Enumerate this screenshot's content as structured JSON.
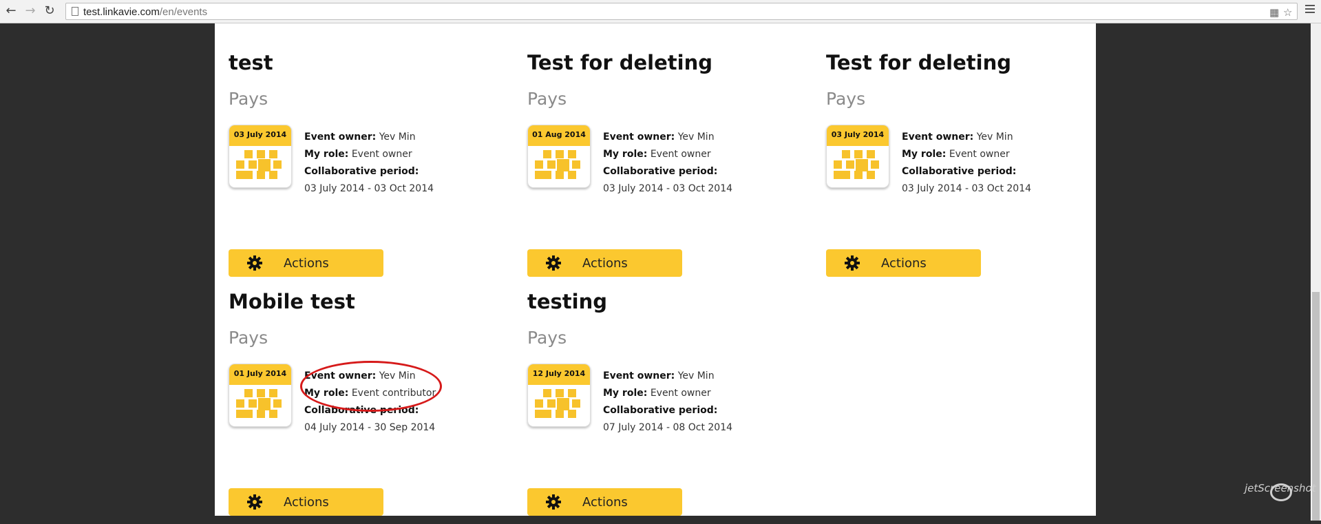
{
  "browser": {
    "url_host": "test.linkavie.com",
    "url_path": "/en/events",
    "back_icon": "arrow-left-icon",
    "forward_icon": "arrow-right-icon",
    "reload_icon": "reload-icon",
    "page_icon": "page-icon",
    "translate_icon": "translate-icon",
    "star_icon": "star-icon",
    "menu_icon": "menu-icon"
  },
  "events": [
    {
      "title": "test",
      "subtitle": "Pays",
      "date": "03 July 2014",
      "owner_label": "Event owner:",
      "owner": "Yev Min",
      "role_label": "My role:",
      "role": "Event owner",
      "period_label": "Collaborative period:",
      "period": "03 July 2014 - 03 Oct 2014",
      "actions_label": "Actions"
    },
    {
      "title": "Test for deleting",
      "subtitle": "Pays",
      "date": "01 Aug 2014",
      "owner_label": "Event owner:",
      "owner": "Yev Min",
      "role_label": "My role:",
      "role": "Event owner",
      "period_label": "Collaborative period:",
      "period": "03 July 2014 - 03 Oct 2014",
      "actions_label": "Actions"
    },
    {
      "title": "Test for deleting",
      "subtitle": "Pays",
      "date": "03 July 2014",
      "owner_label": "Event owner:",
      "owner": "Yev Min",
      "role_label": "My role:",
      "role": "Event owner",
      "period_label": "Collaborative period:",
      "period": "03 July 2014 - 03 Oct 2014",
      "actions_label": "Actions"
    },
    {
      "title": "Mobile test",
      "subtitle": "Pays",
      "date": "01 July 2014",
      "owner_label": "Event owner:",
      "owner": "Yev Min",
      "role_label": "My role:",
      "role": "Event contributor",
      "period_label": "Collaborative period:",
      "period": "04 July 2014 - 30 Sep 2014",
      "actions_label": "Actions"
    },
    {
      "title": "testing",
      "subtitle": "Pays",
      "date": "12 July 2014",
      "owner_label": "Event owner:",
      "owner": "Yev Min",
      "role_label": "My role:",
      "role": "Event owner",
      "period_label": "Collaborative period:",
      "period": "07 July 2014 - 08 Oct 2014",
      "actions_label": "Actions"
    }
  ],
  "watermark": "jetScreenshot",
  "colors": {
    "accent": "#fbc82f",
    "highlight": "#d61a1a",
    "background": "#2d2d2d"
  }
}
